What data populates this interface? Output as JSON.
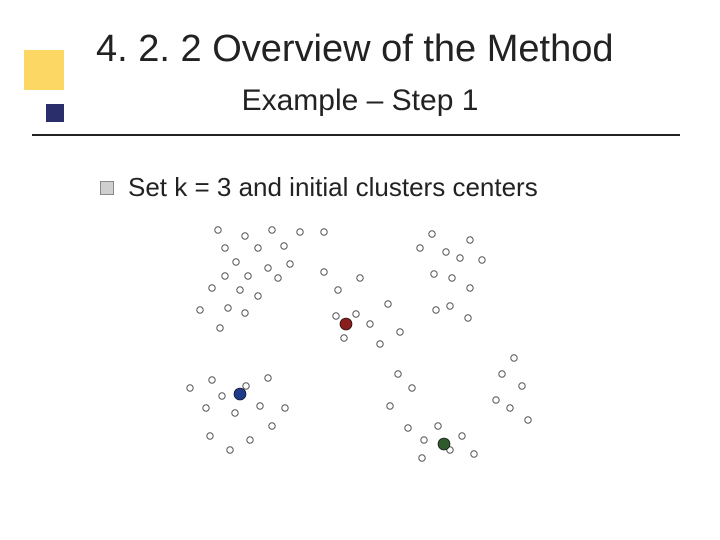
{
  "title": "4. 2. 2 Overview of the Method",
  "subtitle": "Example – Step 1",
  "bullet": "Set k = 3 and initial clusters centers",
  "chart_data": {
    "type": "scatter",
    "title": "",
    "xlabel": "",
    "ylabel": "",
    "xlim": [
      0,
      400
    ],
    "ylim": [
      0,
      260
    ],
    "series": [
      {
        "name": "points",
        "color": "#ffffff",
        "radius": 3.2,
        "values": [
          [
            50,
            92
          ],
          [
            62,
            70
          ],
          [
            78,
            90
          ],
          [
            90,
            72
          ],
          [
            70,
            110
          ],
          [
            95,
            95
          ],
          [
            108,
            78
          ],
          [
            40,
            170
          ],
          [
            56,
            190
          ],
          [
            62,
            162
          ],
          [
            72,
            178
          ],
          [
            85,
            195
          ],
          [
            96,
            168
          ],
          [
            110,
            188
          ],
          [
            118,
            160
          ],
          [
            60,
            218
          ],
          [
            80,
            232
          ],
          [
            100,
            222
          ],
          [
            122,
            208
          ],
          [
            135,
            190
          ],
          [
            68,
            12
          ],
          [
            95,
            18
          ],
          [
            108,
            30
          ],
          [
            122,
            12
          ],
          [
            134,
            28
          ],
          [
            150,
            14
          ],
          [
            140,
            46
          ],
          [
            128,
            60
          ],
          [
            118,
            50
          ],
          [
            98,
            58
          ],
          [
            86,
            44
          ],
          [
            75,
            30
          ],
          [
            75,
            58
          ],
          [
            174,
            14
          ],
          [
            174,
            54
          ],
          [
            188,
            72
          ],
          [
            186,
            98
          ],
          [
            194,
            120
          ],
          [
            206,
            96
          ],
          [
            210,
            60
          ],
          [
            220,
            106
          ],
          [
            230,
            126
          ],
          [
            238,
            86
          ],
          [
            250,
            114
          ],
          [
            248,
            156
          ],
          [
            262,
            170
          ],
          [
            240,
            188
          ],
          [
            270,
            30
          ],
          [
            282,
            16
          ],
          [
            296,
            34
          ],
          [
            284,
            56
          ],
          [
            302,
            60
          ],
          [
            310,
            40
          ],
          [
            320,
            22
          ],
          [
            332,
            42
          ],
          [
            320,
            70
          ],
          [
            300,
            88
          ],
          [
            286,
            92
          ],
          [
            318,
            100
          ],
          [
            258,
            210
          ],
          [
            274,
            222
          ],
          [
            288,
            208
          ],
          [
            272,
            240
          ],
          [
            300,
            232
          ],
          [
            312,
            218
          ],
          [
            324,
            236
          ],
          [
            352,
            156
          ],
          [
            364,
            140
          ],
          [
            372,
            168
          ],
          [
            360,
            190
          ],
          [
            378,
            202
          ],
          [
            346,
            182
          ]
        ]
      }
    ],
    "centers": [
      {
        "name": "center-red",
        "color": "#8a1e1e",
        "radius": 6,
        "x": 196,
        "y": 106
      },
      {
        "name": "center-blue",
        "color": "#1f3a8a",
        "radius": 6,
        "x": 90,
        "y": 176
      },
      {
        "name": "center-green",
        "color": "#2e5a2e",
        "radius": 6,
        "x": 294,
        "y": 226
      }
    ]
  }
}
